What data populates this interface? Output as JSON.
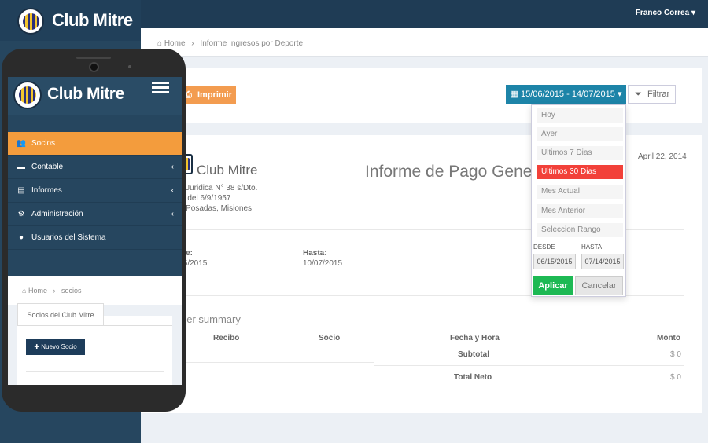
{
  "brand": {
    "name": "Club Mitre"
  },
  "header": {
    "user_name": "Franco Correa",
    "user_caret": "▾"
  },
  "breadcrumb": {
    "home": "Home",
    "current": "Informe Ingresos por Deporte"
  },
  "toolbar": {
    "print_label": "Imprimir",
    "date_range": "15/06/2015 - 14/07/2015",
    "filter_label": "Filtrar"
  },
  "date_picker": {
    "ranges": [
      "Hoy",
      "Ayer",
      "Ultimos 7 Dias",
      "Ultimos 30 Dias",
      "Mes Actual",
      "Mes Anterior",
      "Seleccion Rango"
    ],
    "active_index": 3,
    "desde_label": "DESDE",
    "hasta_label": "HASTA",
    "desde_value": "06/15/2015",
    "hasta_value": "07/14/2015",
    "apply_label": "Aplicar",
    "cancel_label": "Cancelar"
  },
  "report": {
    "org_name": "Club Mitre",
    "address_lines": [
      "- Juridica N° 38 s/Dto.",
      "n del 6/9/1957",
      "- Posadas, Misiones"
    ],
    "title": "Informe de Pago Gene",
    "date": "April 22, 2014",
    "desde_label": "de:",
    "desde_value": "/5/2015",
    "hasta_label": "Hasta:",
    "hasta_value": "10/07/2015",
    "summary_title": "der summary",
    "columns": {
      "recibo": "Recibo",
      "socio": "Socio",
      "fecha": "Fecha y Hora",
      "monto": "Monto"
    },
    "subtotal_label": "Subtotal",
    "subtotal_value": "$ 0",
    "total_label": "Total Neto",
    "total_value": "$ 0"
  },
  "mobile": {
    "menu": [
      {
        "label": "Socios",
        "icon": "users-icon",
        "active": true,
        "has_children": false
      },
      {
        "label": "Contable",
        "icon": "book-icon",
        "active": false,
        "has_children": true
      },
      {
        "label": "Informes",
        "icon": "file-icon",
        "active": false,
        "has_children": true
      },
      {
        "label": "Administración",
        "icon": "cogs-icon",
        "active": false,
        "has_children": true
      },
      {
        "label": "Usuarios del Sistema",
        "icon": "user-icon",
        "active": false,
        "has_children": false
      }
    ],
    "breadcrumb": {
      "home": "Home",
      "current": "socios"
    },
    "tab_label": "Socios del Club Mitre",
    "new_button": "Nuevo Socio"
  },
  "colors": {
    "accent_orange": "#f39c3d",
    "accent_blue": "#1d84a8",
    "active_red": "#f2413a",
    "apply_green": "#1db954",
    "sidebar": "#26465f"
  }
}
